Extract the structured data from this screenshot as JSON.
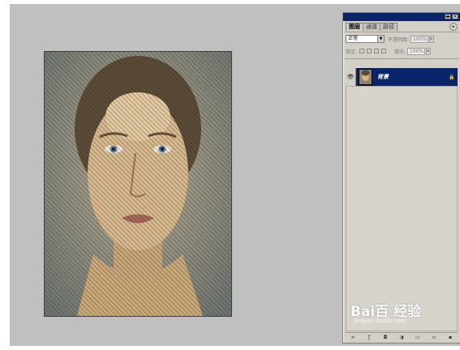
{
  "app": {
    "workspace_color": "#c0c0c0",
    "panel_color": "#d4d0c8",
    "selection_color": "#0a246a"
  },
  "layers_panel": {
    "tabs": [
      {
        "label": "图层"
      },
      {
        "label": "通道"
      },
      {
        "label": "路径"
      }
    ],
    "blend_mode": "正常",
    "opacity_label": "不透明度:",
    "opacity_value": "100%",
    "lock_label": "锁定:",
    "fill_label": "填充:",
    "fill_value": "100%",
    "layers": [
      {
        "name": "背景",
        "visible": true,
        "locked": true,
        "selected": true
      }
    ],
    "bottom_icons": [
      "link-icon",
      "fx-icon",
      "mask-icon",
      "adjustment-icon",
      "folder-icon",
      "new-layer-icon",
      "trash-icon"
    ]
  },
  "watermark": {
    "text": "Bai百 经验",
    "sub": "jingyan.baidu.com"
  }
}
